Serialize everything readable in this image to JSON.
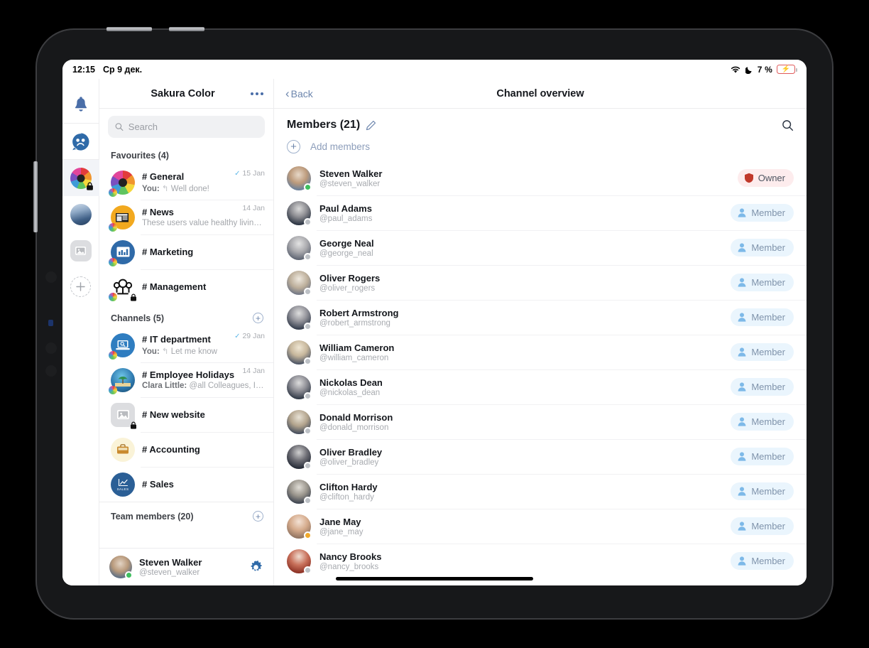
{
  "status_bar": {
    "time": "12:15",
    "date": "Ср 9 дек.",
    "wifi_icon": "wifi-icon",
    "moon_icon": "moon-icon",
    "battery_percent": "7 %",
    "battery_icon": "battery-charging-icon"
  },
  "icon_rail": {
    "items": [
      {
        "name": "notifications-bell",
        "icon": "bell-icon"
      },
      {
        "name": "chats",
        "icon": "chat-bubble-icon"
      },
      {
        "name": "workspace-sakura-color",
        "icon": "flower-avatar-icon",
        "locked": true,
        "active": true
      },
      {
        "name": "workspace-photo",
        "icon": "photo-avatar-icon"
      },
      {
        "name": "workspace-image",
        "icon": "image-placeholder-icon"
      },
      {
        "name": "add-workspace",
        "icon": "plus-icon"
      }
    ]
  },
  "sidebar": {
    "title": "Sakura Color",
    "more_icon": "more-horizontal-icon",
    "search": {
      "placeholder": "Search",
      "value": "",
      "icon": "search-icon"
    },
    "favourites": {
      "label": "Favourites (4)",
      "items": [
        {
          "name": "# General",
          "preview_prefix": "You:",
          "preview": "Well done!",
          "date": "15 Jan",
          "read_tick": "✓",
          "avatar": "flower-icon",
          "locked": false
        },
        {
          "name": "# News",
          "preview_prefix": "",
          "preview": "These users value healthy livin…",
          "date": "14 Jan",
          "read_tick": "",
          "avatar": "newspaper-icon",
          "locked": false
        },
        {
          "name": "# Marketing",
          "preview_prefix": "",
          "preview": "",
          "date": "",
          "read_tick": "",
          "avatar": "chart-icon",
          "locked": false
        },
        {
          "name": "# Management",
          "preview_prefix": "",
          "preview": "",
          "date": "",
          "read_tick": "",
          "avatar": "people-group-icon",
          "locked": true
        }
      ]
    },
    "channels": {
      "label": "Channels (5)",
      "add_icon": "plus-circle-icon",
      "items": [
        {
          "name": "# IT department",
          "preview_prefix": "You:",
          "preview": "Let me know",
          "date": "29 Jan",
          "read_tick": "✓",
          "avatar": "laptop-icon",
          "locked": false
        },
        {
          "name": "# Employee Holidays",
          "preview_prefix": "Clara Little:",
          "preview": "@all Colleagues, I …",
          "date": "14 Jan",
          "read_tick": "",
          "avatar": "beach-icon",
          "locked": false
        },
        {
          "name": "# New website",
          "preview_prefix": "",
          "preview": "",
          "date": "",
          "read_tick": "",
          "avatar": "image-placeholder-icon",
          "locked": true
        },
        {
          "name": "# Accounting",
          "preview_prefix": "",
          "preview": "",
          "date": "",
          "read_tick": "",
          "avatar": "briefcase-icon",
          "locked": false
        },
        {
          "name": "# Sales",
          "preview_prefix": "",
          "preview": "",
          "date": "",
          "read_tick": "",
          "avatar": "sales-chart-icon",
          "locked": false
        }
      ]
    },
    "team_members": {
      "label": "Team members (20)",
      "add_icon": "plus-circle-icon"
    },
    "current_user": {
      "name": "Steven Walker",
      "handle": "@steven_walker",
      "status": "online",
      "settings_icon": "gear-icon"
    }
  },
  "panel": {
    "back_label": "Back",
    "back_icon": "chevron-left-icon",
    "title": "Channel overview",
    "members_title": "Members (21)",
    "edit_icon": "pencil-icon",
    "search_icon": "search-icon",
    "add_members_label": "Add members",
    "add_members_icon": "plus-circle-icon",
    "members": [
      {
        "name": "Steven Walker",
        "handle": "@steven_walker",
        "role": "Owner",
        "role_icon": "shield-icon",
        "status": "online"
      },
      {
        "name": "Paul Adams",
        "handle": "@paul_adams",
        "role": "Member",
        "role_icon": "person-icon",
        "status": "offline"
      },
      {
        "name": "George Neal",
        "handle": "@george_neal",
        "role": "Member",
        "role_icon": "person-icon",
        "status": "offline"
      },
      {
        "name": "Oliver Rogers",
        "handle": "@oliver_rogers",
        "role": "Member",
        "role_icon": "person-icon",
        "status": "offline"
      },
      {
        "name": "Robert Armstrong",
        "handle": "@robert_armstrong",
        "role": "Member",
        "role_icon": "person-icon",
        "status": "offline"
      },
      {
        "name": "William Cameron",
        "handle": "@william_cameron",
        "role": "Member",
        "role_icon": "person-icon",
        "status": "offline"
      },
      {
        "name": "Nickolas Dean",
        "handle": "@nickolas_dean",
        "role": "Member",
        "role_icon": "person-icon",
        "status": "offline"
      },
      {
        "name": "Donald Morrison",
        "handle": "@donald_morrison",
        "role": "Member",
        "role_icon": "person-icon",
        "status": "offline"
      },
      {
        "name": "Oliver Bradley",
        "handle": "@oliver_bradley",
        "role": "Member",
        "role_icon": "person-icon",
        "status": "offline"
      },
      {
        "name": "Clifton Hardy",
        "handle": "@clifton_hardy",
        "role": "Member",
        "role_icon": "person-icon",
        "status": "offline"
      },
      {
        "name": "Jane May",
        "handle": "@jane_may",
        "role": "Member",
        "role_icon": "person-icon",
        "status": "away"
      },
      {
        "name": "Nancy Brooks",
        "handle": "@nancy_brooks",
        "role": "Member",
        "role_icon": "person-icon",
        "status": "offline"
      }
    ]
  },
  "colors": {
    "accent_blue": "#4a6ea8",
    "owner_badge_bg": "#fdeced",
    "owner_icon": "#c0392b",
    "member_badge_bg": "#eaf5fd",
    "member_icon": "#7db9e8",
    "online_green": "#3fbf5f",
    "away_orange": "#f0a92c",
    "offline_gray": "#bdc1c6"
  }
}
